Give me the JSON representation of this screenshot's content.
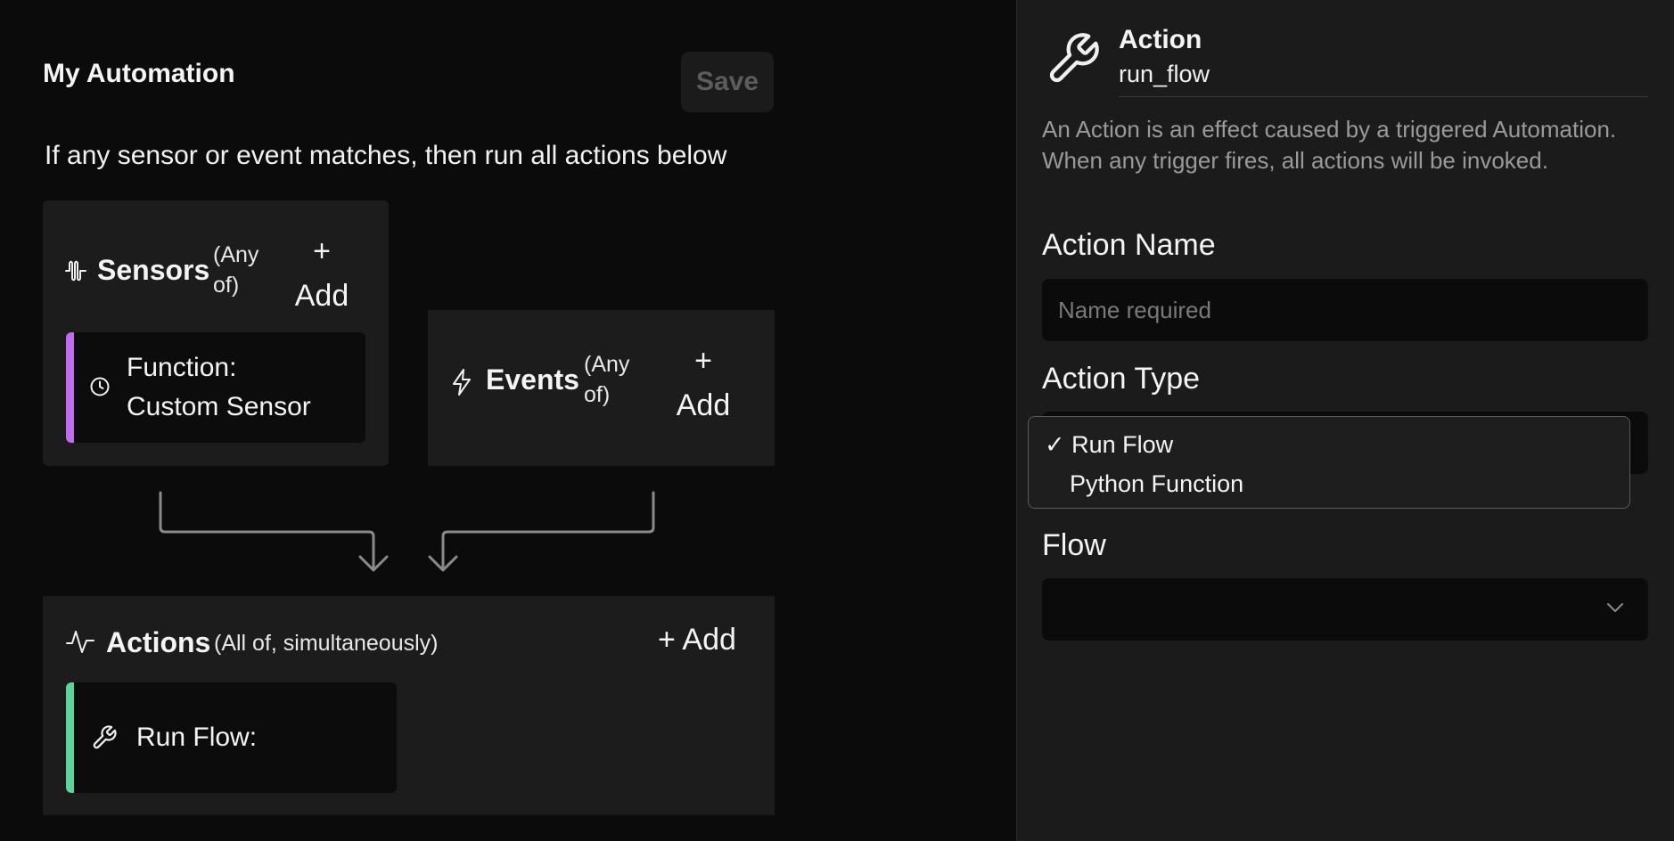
{
  "automation": {
    "title": "My Automation",
    "save_label": "Save",
    "rule_text": "If any sensor or event matches, then run all actions below"
  },
  "sensors": {
    "title": "Sensors",
    "qualifier_line1": "(Any",
    "qualifier_line2": "of)",
    "add_plus": "+",
    "add_label": "Add",
    "items": [
      {
        "line1": "Function:",
        "line2": "Custom Sensor",
        "accent": "#c06cf0",
        "icon": "clock-icon"
      }
    ]
  },
  "events": {
    "title": "Events",
    "qualifier_line1": "(Any",
    "qualifier_line2": "of)",
    "add_plus": "+",
    "add_label": "Add"
  },
  "actions": {
    "title": "Actions",
    "qualifier": "(All of, simultaneously)",
    "add_label": "+ Add",
    "items": [
      {
        "label": "Run Flow:",
        "accent": "#5fd49a",
        "icon": "wrench-icon"
      }
    ]
  },
  "detail_panel": {
    "icon": "wrench-icon",
    "title": "Action",
    "subtitle": "run_flow",
    "description": "An Action is an effect caused by a triggered Automation. When any trigger fires, all actions will be invoked.",
    "name_label": "Action Name",
    "name_placeholder": "Name required",
    "name_value": "",
    "type_label": "Action Type",
    "type_options": [
      {
        "check": "✓",
        "label": "Run Flow",
        "selected": true
      },
      {
        "check": "",
        "label": "Python Function",
        "selected": false
      }
    ],
    "flow_label": "Flow",
    "flow_value": ""
  }
}
